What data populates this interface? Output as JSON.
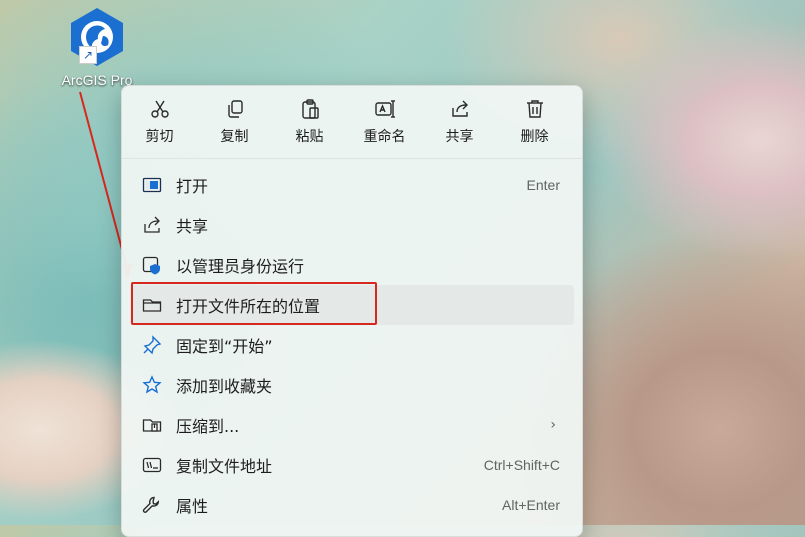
{
  "desktop_icon": {
    "label": "ArcGIS Pro",
    "icon": "arcgis-globe-icon",
    "shortcut_badge": "shortcut-arrow-icon"
  },
  "colors": {
    "accent": "#1a5fb4",
    "annotation_red": "#d7281f",
    "menu_bg": "#f0f6f3",
    "highlight": "#e4e9e7"
  },
  "toolbar": {
    "items": [
      {
        "label": "剪切",
        "icon": "cut-icon"
      },
      {
        "label": "复制",
        "icon": "copy-icon"
      },
      {
        "label": "粘贴",
        "icon": "paste-icon"
      },
      {
        "label": "重命名",
        "icon": "rename-icon"
      },
      {
        "label": "共享",
        "icon": "share-icon"
      },
      {
        "label": "删除",
        "icon": "delete-icon"
      }
    ]
  },
  "menu": {
    "items": [
      {
        "label": "打开",
        "shortcut": "Enter",
        "icon": "open-window-icon"
      },
      {
        "label": "共享",
        "shortcut": "",
        "icon": "share-icon"
      },
      {
        "label": "以管理员身份运行",
        "shortcut": "",
        "icon": "admin-shield-icon"
      },
      {
        "label": "打开文件所在的位置",
        "shortcut": "",
        "icon": "folder-icon",
        "highlighted": true
      },
      {
        "label": "固定到“开始”",
        "shortcut": "",
        "icon": "pin-icon"
      },
      {
        "label": "添加到收藏夹",
        "shortcut": "",
        "icon": "star-icon"
      },
      {
        "label": "压缩到...",
        "shortcut": "",
        "icon": "zip-icon",
        "submenu": true
      },
      {
        "label": "复制文件地址",
        "shortcut": "Ctrl+Shift+C",
        "icon": "copy-path-icon"
      },
      {
        "label": "属性",
        "shortcut": "Alt+Enter",
        "icon": "wrench-icon"
      }
    ],
    "submenu_glyph": "›"
  }
}
